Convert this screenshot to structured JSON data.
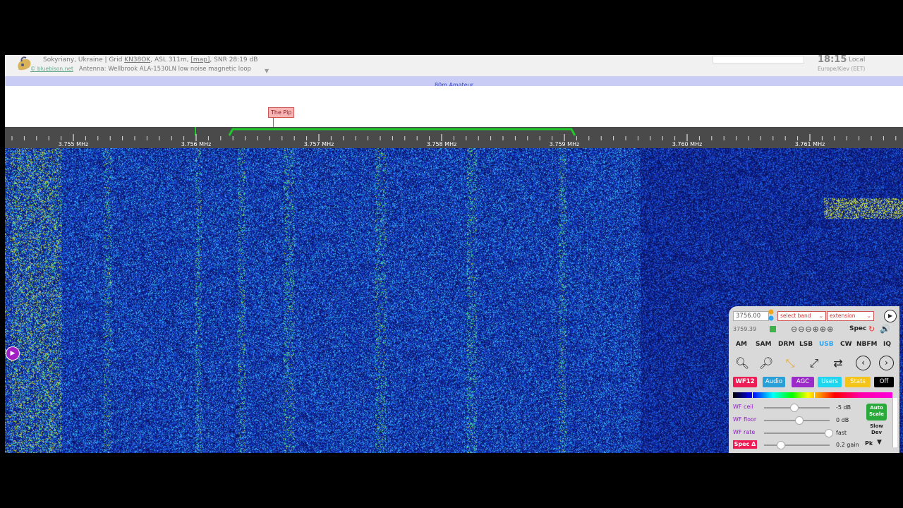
{
  "header": {
    "site_line1_prefix": "Sokyriany, Ukraine | Grid ",
    "grid": "KN38OK",
    "site_line1_suffix": ", ASL 311m, ",
    "map_link": "[map]",
    "snr": ", SNR 28:19 dB",
    "credit_link": "© bluebison.net",
    "antenna": "Antenna: Wellbrook ALA-1530LN low noise magnetic loop",
    "time": "18:15",
    "time_label": "Local",
    "timezone": "Europe/Kiev (EET)"
  },
  "band": {
    "name": "80m Amateur"
  },
  "labels": {
    "pip": "The Pip"
  },
  "scale": {
    "ticks": [
      "3.755 MHz",
      "3.756 MHz",
      "3.757 MHz",
      "3.758 MHz",
      "3.759 MHz",
      "3.760 MHz",
      "3.761 MHz"
    ],
    "passband_color": "#1fc92a",
    "marker_color": "#1fc92a"
  },
  "panel": {
    "freq_value": "3756.00",
    "freq_secondary": "3759.39",
    "band_select": "select band",
    "extension_select": "extension",
    "zoom_steps": "⊖⊖⊖⊕⊕⊕",
    "spec_label": "Spec",
    "modes": [
      "AM",
      "SAM",
      "DRM",
      "LSB",
      "USB",
      "CW",
      "NBFM",
      "IQ"
    ],
    "active_mode": "USB",
    "tabs": {
      "wf": "WF12",
      "audio": "Audio",
      "agc": "AGC",
      "users": "Users",
      "stats": "Stats",
      "off": "Off"
    },
    "sliders": {
      "wf_ceil": {
        "label": "WF ceil",
        "value": "-5 dB",
        "level": 0.45
      },
      "wf_floor": {
        "label": "WF floor",
        "value": "0 dB",
        "level": 0.53
      },
      "wf_rate": {
        "label": "WF rate",
        "value": "fast",
        "level": 0.98
      },
      "spec_delta": {
        "label": "Spec Δ",
        "value": "0.2 gain",
        "level": 0.25
      }
    },
    "auto_scale": "Auto Scale",
    "slow_dev": "Slow Dev",
    "pk": "Pk"
  },
  "colors": {
    "waterfall_base": "#0a1a8e",
    "accent_magenta": "#ee1c55",
    "accent_blue": "#2aa4f0"
  }
}
